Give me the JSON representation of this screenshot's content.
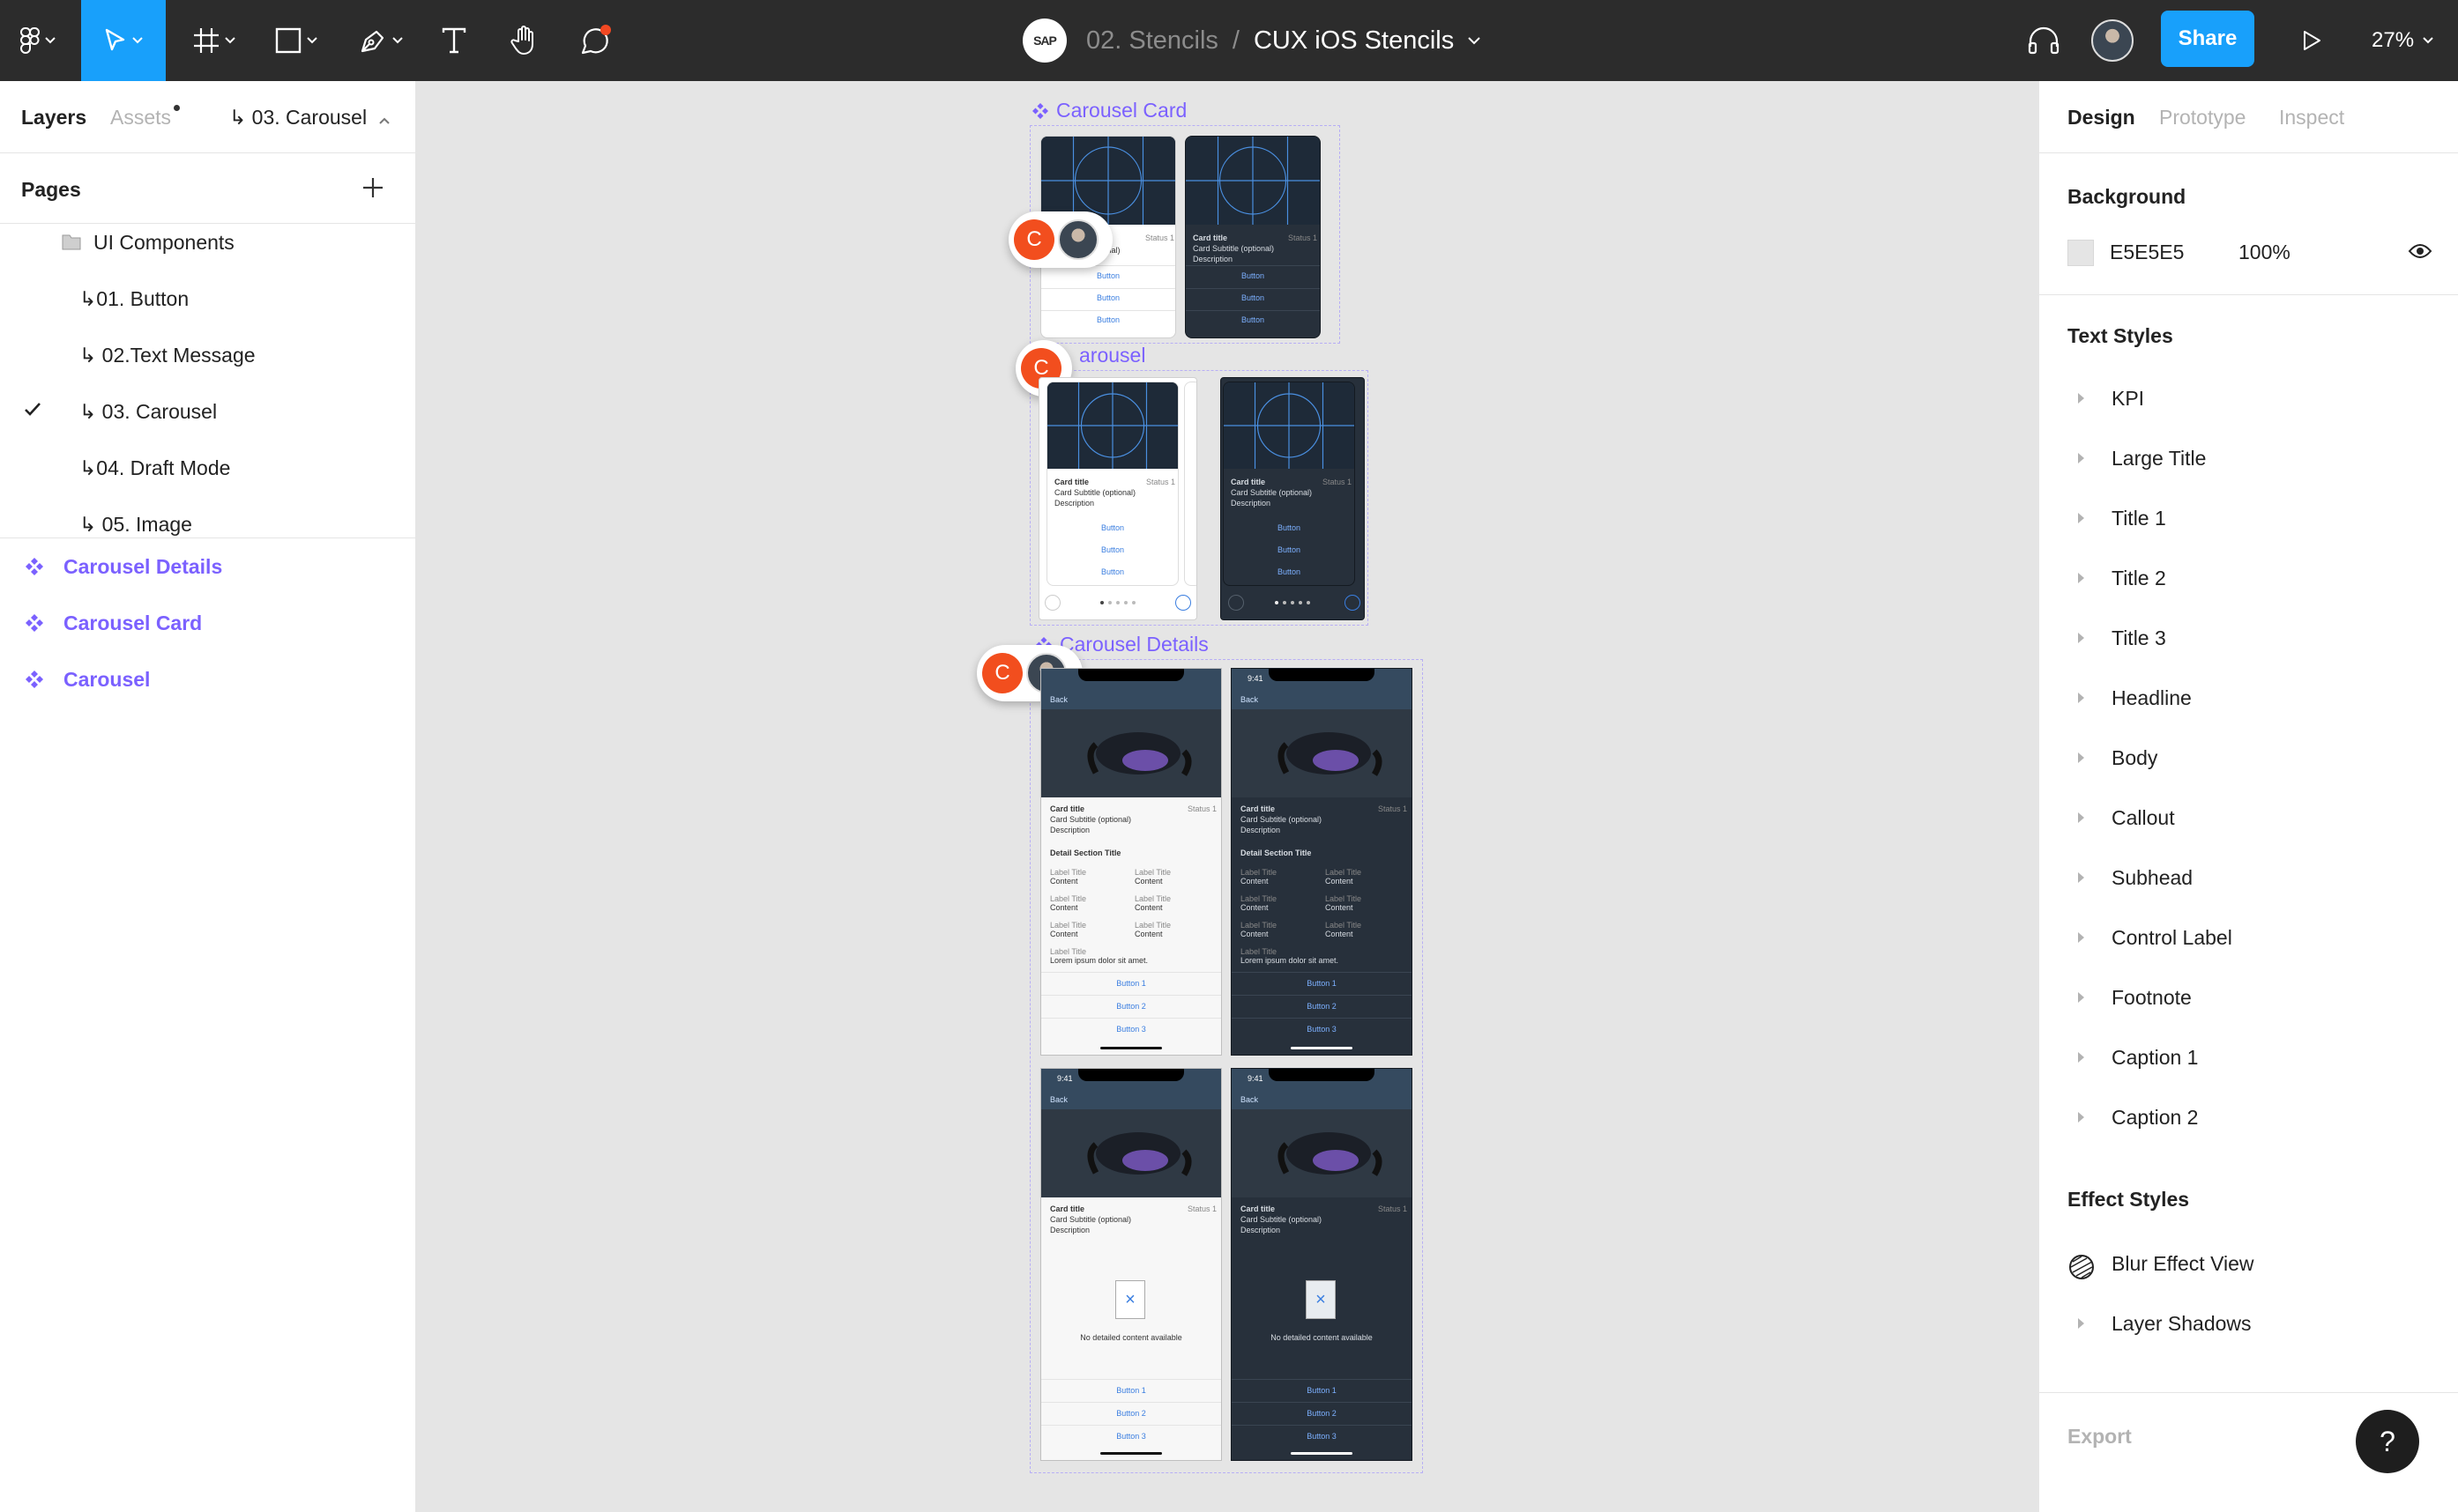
{
  "toolbar": {
    "menu_icon": "figma-logo-icon",
    "tools": [
      "move-tool-icon",
      "frame-tool-icon",
      "shape-tool-icon",
      "pen-tool-icon",
      "text-tool-icon",
      "hand-tool-icon",
      "comment-tool-icon"
    ],
    "logo_text": "SAP",
    "project": "02. Stencils",
    "separator": "/",
    "file": "CUX iOS Stencils",
    "share_label": "Share",
    "zoom": "27%",
    "accent_color": "#18a0fb"
  },
  "left_panel": {
    "tabs": {
      "layers": "Layers",
      "assets": "Assets",
      "page_switch": "↳ 03. Carousel"
    },
    "pages_title": "Pages",
    "pages": [
      {
        "label": "UI Components"
      },
      {
        "label": "↳01. Button"
      },
      {
        "label": "↳ 02.Text Message"
      },
      {
        "label": "↳ 03. Carousel",
        "selected": true
      },
      {
        "label": "↳04. Draft Mode"
      },
      {
        "label": "↳ 05. Image"
      }
    ],
    "components": [
      {
        "label": "Carousel Details"
      },
      {
        "label": "Carousel Card"
      },
      {
        "label": "Carousel"
      }
    ],
    "component_color": "#7b61ff"
  },
  "canvas": {
    "frame_labels": {
      "carousel_card": "Carousel Card",
      "carousel": "arousel",
      "carousel_details": "Carousel Details"
    },
    "card": {
      "title": "Card title",
      "status": "Status 1",
      "subtitle": "Card Subtitle (optional)",
      "description": "Description",
      "subtitle_partial": "ptional)",
      "button": "Button"
    },
    "details": {
      "time": "9:41",
      "back": "Back",
      "section_title": "Detail Section Title",
      "label_title": "Label Title",
      "content": "Content",
      "lorem": "Lorem ipsum dolor sit amet.",
      "buttons": [
        "Button 1",
        "Button 2",
        "Button 3"
      ],
      "empty_text": "No detailed content available"
    },
    "collaborator_initial": "C"
  },
  "right_panel": {
    "tabs": {
      "design": "Design",
      "prototype": "Prototype",
      "inspect": "Inspect"
    },
    "background": {
      "title": "Background",
      "hex": "E5E5E5",
      "opacity": "100%"
    },
    "text_styles_title": "Text Styles",
    "text_styles": [
      "KPI",
      "Large Title",
      "Title 1",
      "Title 2",
      "Title 3",
      "Headline",
      "Body",
      "Callout",
      "Subhead",
      "Control Label",
      "Footnote",
      "Caption 1",
      "Caption 2"
    ],
    "effect_styles_title": "Effect Styles",
    "effect_styles": [
      "Blur Effect View",
      "Layer Shadows"
    ],
    "export_title": "Export",
    "help_label": "?"
  }
}
